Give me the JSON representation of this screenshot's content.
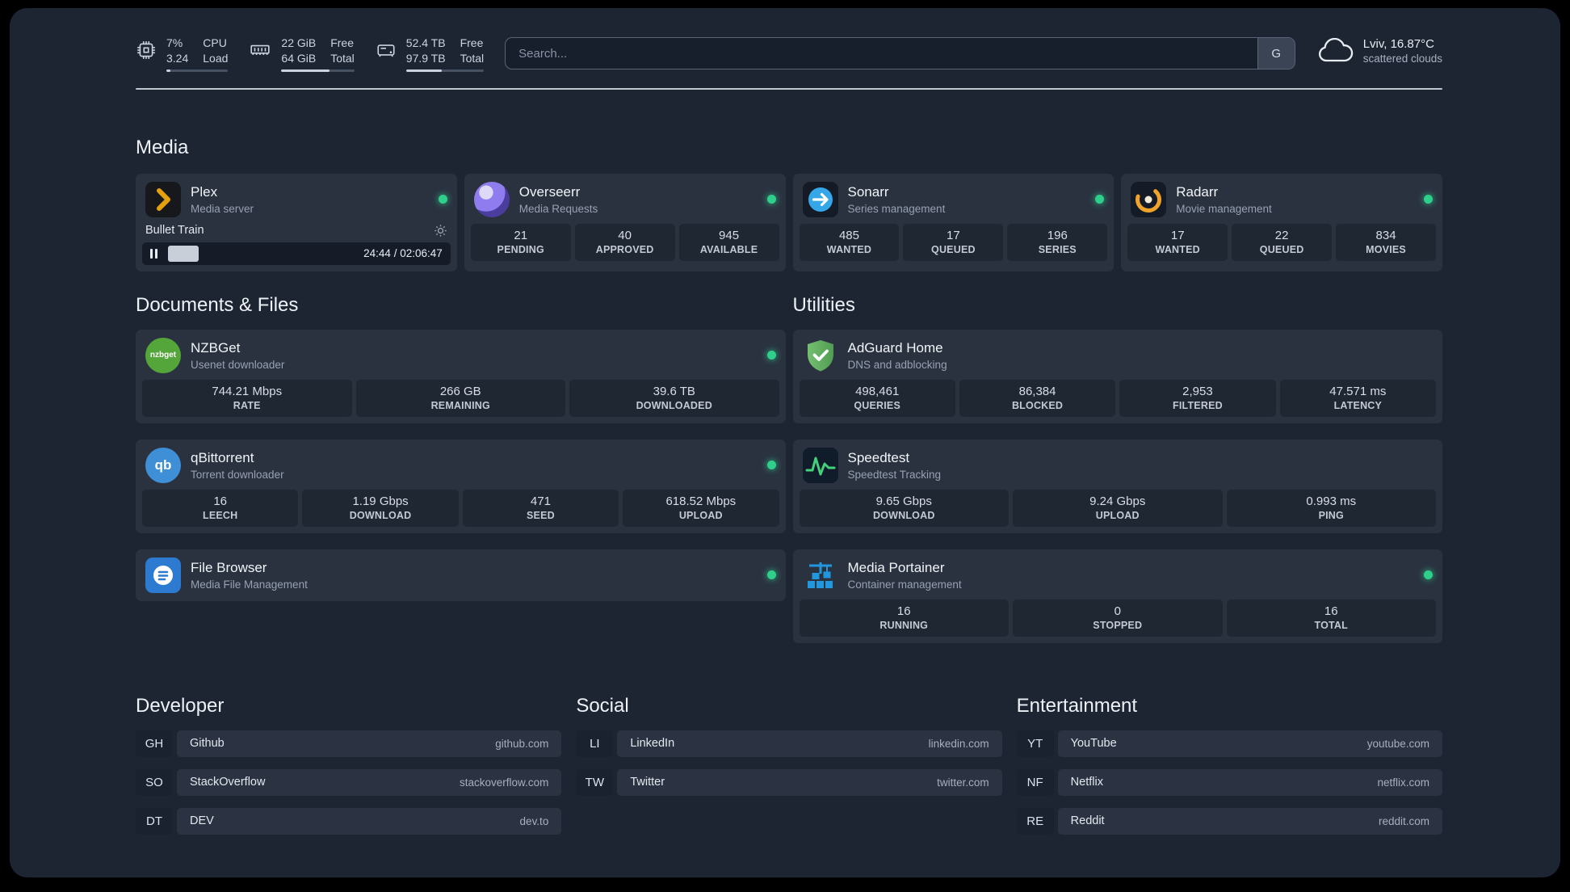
{
  "theme": {
    "panel_bg": "#1d2533",
    "card_bg": "#2a3240",
    "stat_bg": "#1f2733",
    "status_green": "#2ecf8b",
    "plex_gold": "#e5a00d"
  },
  "topbar": {
    "resources": [
      {
        "icon": "cpu-icon",
        "value_top": "7%",
        "value_bottom": "3.24",
        "label_top": "CPU",
        "label_bottom": "Load",
        "used_percent": 7
      },
      {
        "icon": "memory-icon",
        "value_top": "22 GiB",
        "value_bottom": "64 GiB",
        "label_top": "Free",
        "label_bottom": "Total",
        "used_percent": 66
      },
      {
        "icon": "disk-icon",
        "value_top": "52.4 TB",
        "value_bottom": "97.9 TB",
        "label_top": "Free",
        "label_bottom": "Total",
        "used_percent": 46
      }
    ],
    "search": {
      "placeholder": "Search...",
      "provider_button": "G"
    },
    "weather": {
      "icon": "cloud-icon",
      "location": "Lviv, 16.87°C",
      "condition": "scattered clouds"
    }
  },
  "media": {
    "title": "Media",
    "cards": {
      "plex": {
        "icon": "plex-icon",
        "name": "Plex",
        "desc": "Media server",
        "status": "online",
        "player": {
          "title": "Bullet Train",
          "time": "24:44 / 02:06:47",
          "progress_percent": 19
        }
      },
      "overseerr": {
        "icon": "overseerr-icon",
        "name": "Overseerr",
        "desc": "Media Requests",
        "status": "online",
        "stats": [
          {
            "value": "21",
            "label": "PENDING"
          },
          {
            "value": "40",
            "label": "APPROVED"
          },
          {
            "value": "945",
            "label": "AVAILABLE"
          }
        ]
      },
      "sonarr": {
        "icon": "sonarr-icon",
        "name": "Sonarr",
        "desc": "Series management",
        "status": "online",
        "stats": [
          {
            "value": "485",
            "label": "WANTED"
          },
          {
            "value": "17",
            "label": "QUEUED"
          },
          {
            "value": "196",
            "label": "SERIES"
          }
        ]
      },
      "radarr": {
        "icon": "radarr-icon",
        "name": "Radarr",
        "desc": "Movie management",
        "status": "online",
        "stats": [
          {
            "value": "17",
            "label": "WANTED"
          },
          {
            "value": "22",
            "label": "QUEUED"
          },
          {
            "value": "834",
            "label": "MOVIES"
          }
        ]
      }
    }
  },
  "documents": {
    "title": "Documents & Files",
    "cards": {
      "nzbget": {
        "icon": "nzbget-icon",
        "icon_text": "nzbget",
        "name": "NZBGet",
        "desc": "Usenet downloader",
        "status": "online",
        "stats": [
          {
            "value": "744.21 Mbps",
            "label": "RATE"
          },
          {
            "value": "266 GB",
            "label": "REMAINING"
          },
          {
            "value": "39.6 TB",
            "label": "DOWNLOADED"
          }
        ]
      },
      "qbittorrent": {
        "icon": "qbittorrent-icon",
        "icon_text": "qb",
        "name": "qBittorrent",
        "desc": "Torrent downloader",
        "status": "online",
        "stats": [
          {
            "value": "16",
            "label": "LEECH"
          },
          {
            "value": "1.19 Gbps",
            "label": "DOWNLOAD"
          },
          {
            "value": "471",
            "label": "SEED"
          },
          {
            "value": "618.52 Mbps",
            "label": "UPLOAD"
          }
        ]
      },
      "filebrowser": {
        "icon": "filebrowser-icon",
        "name": "File Browser",
        "desc": "Media File Management",
        "status": "online"
      }
    }
  },
  "utilities": {
    "title": "Utilities",
    "cards": {
      "adguard": {
        "icon": "adguard-icon",
        "name": "AdGuard Home",
        "desc": "DNS and adblocking",
        "stats": [
          {
            "value": "498,461",
            "label": "QUERIES"
          },
          {
            "value": "86,384",
            "label": "BLOCKED"
          },
          {
            "value": "2,953",
            "label": "FILTERED"
          },
          {
            "value": "47.571 ms",
            "label": "LATENCY"
          }
        ]
      },
      "speedtest": {
        "icon": "speedtest-icon",
        "name": "Speedtest",
        "desc": "Speedtest Tracking",
        "stats": [
          {
            "value": "9.65 Gbps",
            "label": "DOWNLOAD"
          },
          {
            "value": "9.24 Gbps",
            "label": "UPLOAD"
          },
          {
            "value": "0.993 ms",
            "label": "PING"
          }
        ]
      },
      "portainer": {
        "icon": "portainer-icon",
        "name": "Media Portainer",
        "desc": "Container management",
        "status": "online",
        "stats": [
          {
            "value": "16",
            "label": "RUNNING"
          },
          {
            "value": "0",
            "label": "STOPPED"
          },
          {
            "value": "16",
            "label": "TOTAL"
          }
        ]
      }
    }
  },
  "bookmarks": {
    "groups": [
      {
        "title": "Developer",
        "items": [
          {
            "abbr": "GH",
            "name": "Github",
            "url": "github.com"
          },
          {
            "abbr": "SO",
            "name": "StackOverflow",
            "url": "stackoverflow.com"
          },
          {
            "abbr": "DT",
            "name": "DEV",
            "url": "dev.to"
          }
        ]
      },
      {
        "title": "Social",
        "items": [
          {
            "abbr": "LI",
            "name": "LinkedIn",
            "url": "linkedin.com"
          },
          {
            "abbr": "TW",
            "name": "Twitter",
            "url": "twitter.com"
          }
        ]
      },
      {
        "title": "Entertainment",
        "items": [
          {
            "abbr": "YT",
            "name": "YouTube",
            "url": "youtube.com"
          },
          {
            "abbr": "NF",
            "name": "Netflix",
            "url": "netflix.com"
          },
          {
            "abbr": "RE",
            "name": "Reddit",
            "url": "reddit.com"
          }
        ]
      }
    ]
  }
}
